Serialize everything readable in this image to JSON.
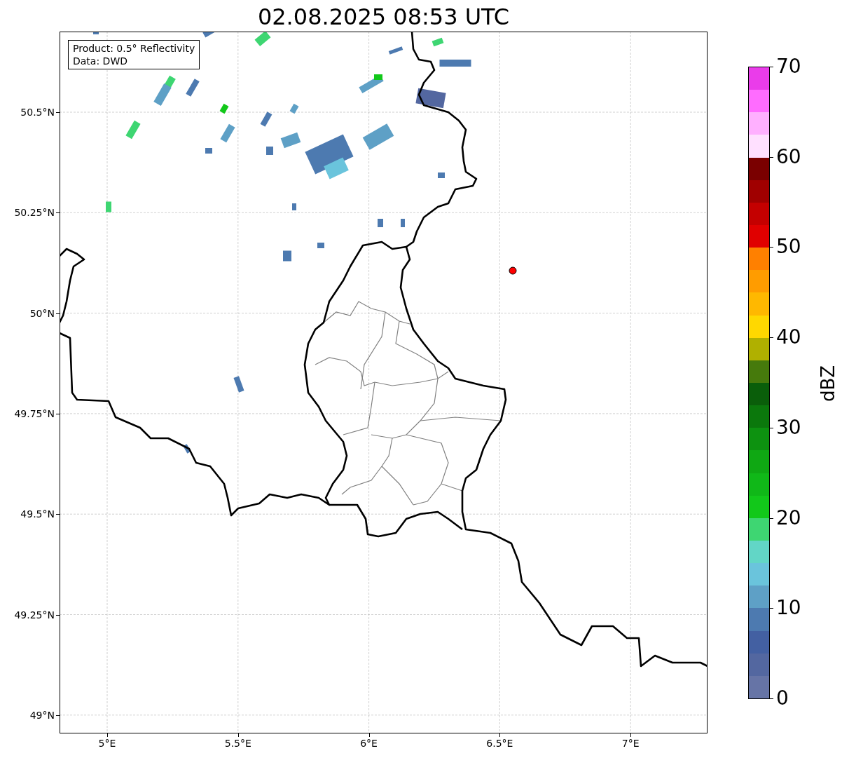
{
  "title": "02.08.2025 08:53 UTC",
  "info_box": [
    "Product: 0.5° Reflectivity",
    "Data: DWD"
  ],
  "lat_ticks": [
    "50.5°N",
    "50.25°N",
    "50°N",
    "49.75°N",
    "49.5°N",
    "49.25°N",
    "49°N"
  ],
  "lon_ticks": [
    "5°E",
    "5.5°E",
    "6°E",
    "6.5°E",
    "7°E"
  ],
  "colorbar": {
    "label": "dBZ",
    "ticks": [
      "70",
      "60",
      "50",
      "40",
      "30",
      "20",
      "10",
      "0"
    ],
    "bins": [
      {
        "color": "#6674a6"
      },
      {
        "color": "#5367a0"
      },
      {
        "color": "#4360a2"
      },
      {
        "color": "#4d7ab0"
      },
      {
        "color": "#5ea0c6"
      },
      {
        "color": "#6ac4dc"
      },
      {
        "color": "#62d6c6"
      },
      {
        "color": "#3ed672"
      },
      {
        "color": "#12c81a"
      },
      {
        "color": "#10b818"
      },
      {
        "color": "#0fa813"
      },
      {
        "color": "#0d9210"
      },
      {
        "color": "#0b780c"
      },
      {
        "color": "#0a5e0a"
      },
      {
        "color": "#467a0c"
      },
      {
        "color": "#b0b000"
      },
      {
        "color": "#ffd800"
      },
      {
        "color": "#ffb800"
      },
      {
        "color": "#ff9c00"
      },
      {
        "color": "#ff8000"
      },
      {
        "color": "#e00000"
      },
      {
        "color": "#c40000"
      },
      {
        "color": "#a00000"
      },
      {
        "color": "#7a0000"
      },
      {
        "color": "#ffe0ff"
      },
      {
        "color": "#ffb0ff"
      },
      {
        "color": "#ff6cff"
      },
      {
        "color": "#ea3cea"
      }
    ]
  }
}
